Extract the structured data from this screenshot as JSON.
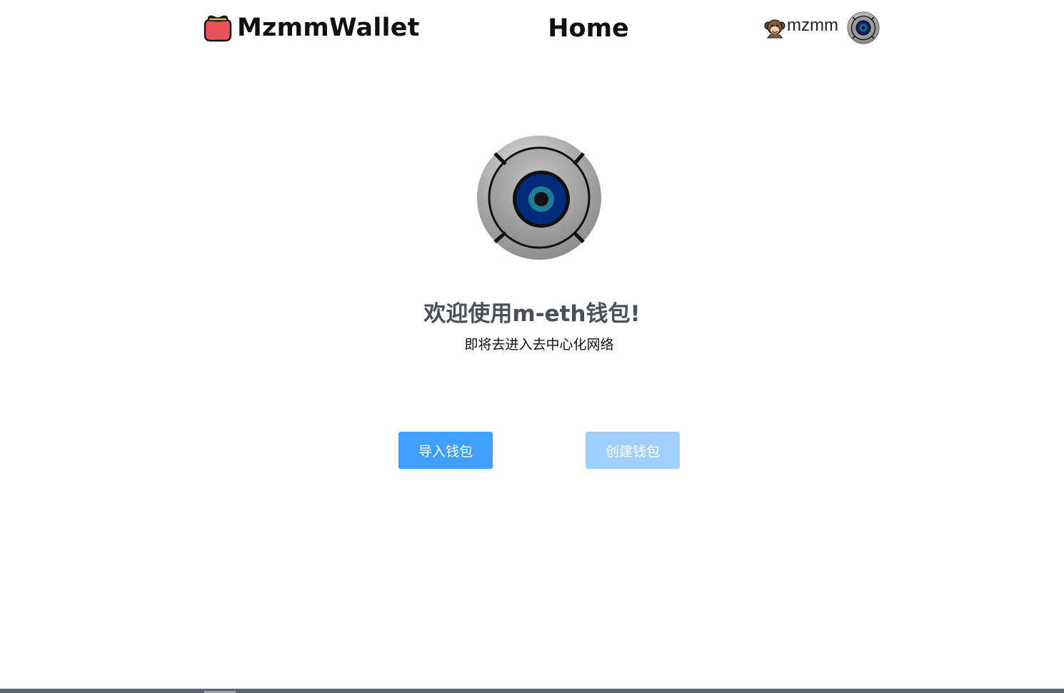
{
  "header": {
    "brand_name": "MzmmWallet",
    "brand_icon": "wallet-icon",
    "page_title": "Home",
    "user_icon": "monkey-icon",
    "username": "mzmm",
    "avatar_icon": "camera-lens-icon"
  },
  "main": {
    "logo_icon": "camera-lens-icon",
    "welcome_title": "欢迎使用m-eth钱包!",
    "subtitle": "即将去进入去中心化网络",
    "import_button_label": "导入钱包",
    "create_button_label": "创建钱包"
  },
  "colors": {
    "primary": "#409eff",
    "primary_disabled": "#a0cfff",
    "title_text": "#4b4f56",
    "brand_icon_fill": "#e8525b",
    "lens_blue": "#002a7a",
    "lens_teal": "#1d7d96"
  }
}
